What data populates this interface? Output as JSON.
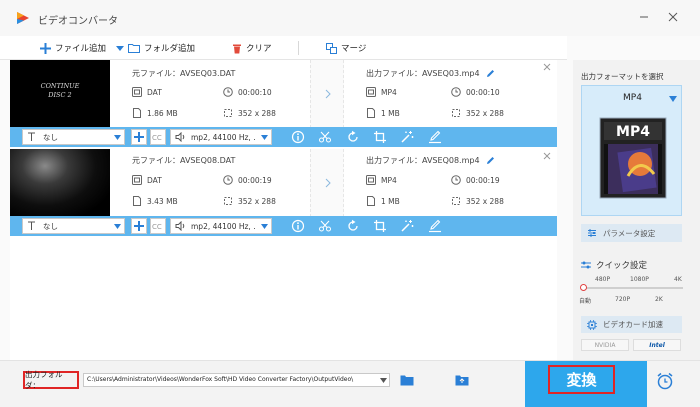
{
  "app": {
    "title": "ビデオコンバータ"
  },
  "toolbar": {
    "add_files": "ファイル追加",
    "add_folder": "フォルダ追加",
    "clear": "クリア",
    "merge": "マージ"
  },
  "files": [
    {
      "thumb_text": [
        "CONTINUE",
        "DISC 2"
      ],
      "source": {
        "name": "元ファイル：AVSEQ03.DAT",
        "format": "DAT",
        "duration": "00:00:10",
        "size": "1.86 MB",
        "resolution": "352 x 288"
      },
      "output": {
        "name": "出力ファイル：AVSEQ03.mp4",
        "format": "MP4",
        "duration": "00:00:10",
        "size": "1 MB",
        "resolution": "352 x 288"
      },
      "subtitle": "なし",
      "audio": "mp2, 44100 Hz, ."
    },
    {
      "thumb_text": [],
      "source": {
        "name": "元ファイル：AVSEQ08.DAT",
        "format": "DAT",
        "duration": "00:00:19",
        "size": "3.43 MB",
        "resolution": "352 x 288"
      },
      "output": {
        "name": "出力ファイル：AVSEQ08.mp4",
        "format": "MP4",
        "duration": "00:00:19",
        "size": "1 MB",
        "resolution": "352 x 288"
      },
      "subtitle": "なし",
      "audio": "mp2, 44100 Hz, ."
    }
  ],
  "right_panel": {
    "title": "出力フォーマットを選択",
    "format": "MP4",
    "format_icon_text": "MP4",
    "param_button": "パラメータ設定",
    "quick_setting": "クイック設定",
    "quality_top": [
      "480P",
      "1080P",
      "4K"
    ],
    "quality_bottom": [
      "自動",
      "720P",
      "2K"
    ],
    "quality_level": "自動",
    "gpu_button": "ビデオカード加速",
    "brands": [
      "NVIDIA",
      "Intel"
    ]
  },
  "bottom": {
    "output_folder_label": "出力フォルダ：",
    "output_path": "C:\\Users\\Administrator\\Videos\\WonderFox Soft\\HD Video Converter Factory\\OutputVideo\\",
    "convert": "変換"
  },
  "colors": {
    "accent": "#2da7ec",
    "control_bar": "#5fb6ee",
    "highlight": "#e02525"
  }
}
